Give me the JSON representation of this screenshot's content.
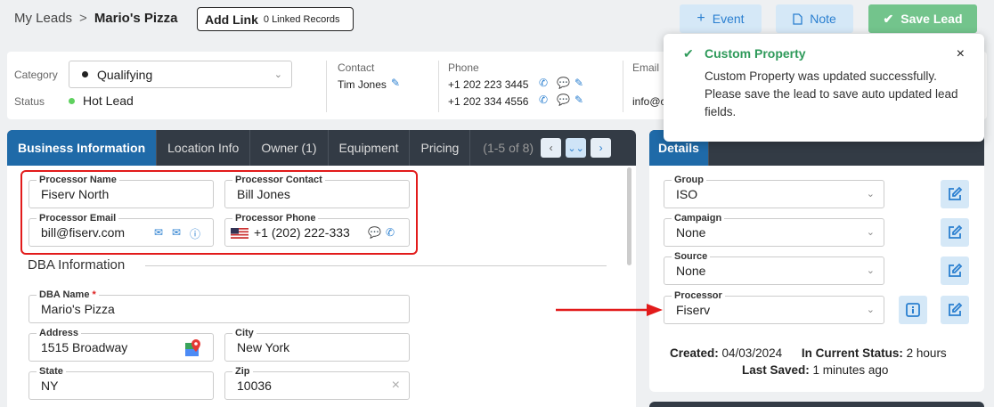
{
  "breadcrumb": {
    "root": "My Leads",
    "separator": ">",
    "current": "Mario's Pizza"
  },
  "add_link": {
    "label": "Add Link",
    "linked": "0 Linked Records"
  },
  "actions": {
    "event": "Event",
    "note": "Note",
    "save": "Save Lead"
  },
  "info": {
    "category_label": "Category",
    "category_value": "Qualifying",
    "status_label": "Status",
    "status_value": "Hot Lead",
    "contact_label": "Contact",
    "contact_value": "Tim Jones",
    "phone_label": "Phone",
    "phone_1": "+1 202 223 3445",
    "phone_2": "+1 202 334 4556",
    "email_label": "Email",
    "email_value": "info@c"
  },
  "toast": {
    "title": "Custom Property",
    "message": "Custom Property was updated successfully. Please save the lead to save auto updated lead fields."
  },
  "tabs": [
    "Business Information",
    "Location Info",
    "Owner (1)",
    "Equipment",
    "Pricing"
  ],
  "tab_range": "(1-5 of 8)",
  "processor": {
    "name_label": "Processor Name",
    "name_value": "Fiserv North",
    "contact_label": "Processor Contact",
    "contact_value": "Bill Jones",
    "email_label": "Processor Email",
    "email_value": "bill@fiserv.com",
    "phone_label": "Processor Phone",
    "phone_value": "+1 (202) 222-333"
  },
  "dba": {
    "section_title": "DBA Information",
    "dba_name_label": "DBA Name",
    "required_mark": "*",
    "dba_name_value": "Mario's Pizza",
    "address_label": "Address",
    "address_value": "1515 Broadway",
    "city_label": "City",
    "city_value": "New York",
    "state_label": "State",
    "state_value": "NY",
    "zip_label": "Zip",
    "zip_value": "10036"
  },
  "details": {
    "tab": "Details",
    "group_label": "Group",
    "group_value": "ISO",
    "campaign_label": "Campaign",
    "campaign_value": "None",
    "source_label": "Source",
    "source_value": "None",
    "processor_label": "Processor",
    "processor_value": "Fiserv",
    "created_label": "Created:",
    "created_value": "04/03/2024",
    "status_time_label": "In Current Status:",
    "status_time_value": "2 hours",
    "saved_label": "Last Saved:",
    "saved_value": "1 minutes ago"
  },
  "colors": {
    "accent": "#2a7fd0",
    "highlight": "#e21b1b",
    "success": "#2e9a5a",
    "tab_active": "#1f6aa8"
  }
}
